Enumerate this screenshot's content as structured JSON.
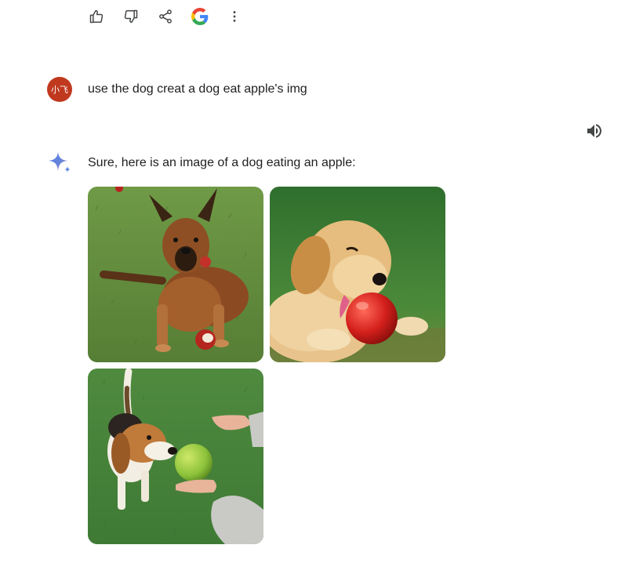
{
  "toolbar": {
    "items": [
      {
        "icon": "thumbs-up-icon"
      },
      {
        "icon": "thumbs-down-icon"
      },
      {
        "icon": "share-icon"
      },
      {
        "icon": "google-g-icon"
      },
      {
        "icon": "more-vert-icon"
      }
    ]
  },
  "user": {
    "avatar_text": "小飞",
    "avatar_color": "#c0391f",
    "message": "use the dog creat a dog eat apple's img"
  },
  "response": {
    "speaker_icon": "speaker-icon",
    "logo_icon": "sparkle-icon",
    "text": "Sure, here is an image of a dog eating an apple:",
    "images": [
      {
        "subject": "german-shepherd-with-apple"
      },
      {
        "subject": "golden-retriever-puppy-with-red-apple"
      },
      {
        "subject": "beagle-with-green-apple"
      }
    ]
  }
}
